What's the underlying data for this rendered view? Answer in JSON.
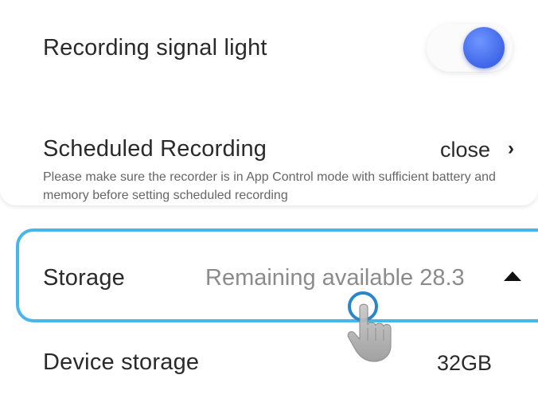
{
  "signal_light": {
    "label": "Recording signal light",
    "enabled": true,
    "accent_color": "#4a70f0"
  },
  "scheduled_recording": {
    "label": "Scheduled Recording",
    "value": "close",
    "chevron": "chevron-right-icon",
    "hint": "Please make sure the recorder is in App Control mode with sufficient battery and memory before setting scheduled recording"
  },
  "storage": {
    "label": "Storage",
    "value": "Remaining available 28.3",
    "caret": "caret-up-icon",
    "highlight_color": "#47b6ea"
  },
  "device_storage": {
    "label": "Device storage",
    "value": "32GB"
  },
  "tap_indicator": {
    "icon": "tap-hand-icon"
  }
}
